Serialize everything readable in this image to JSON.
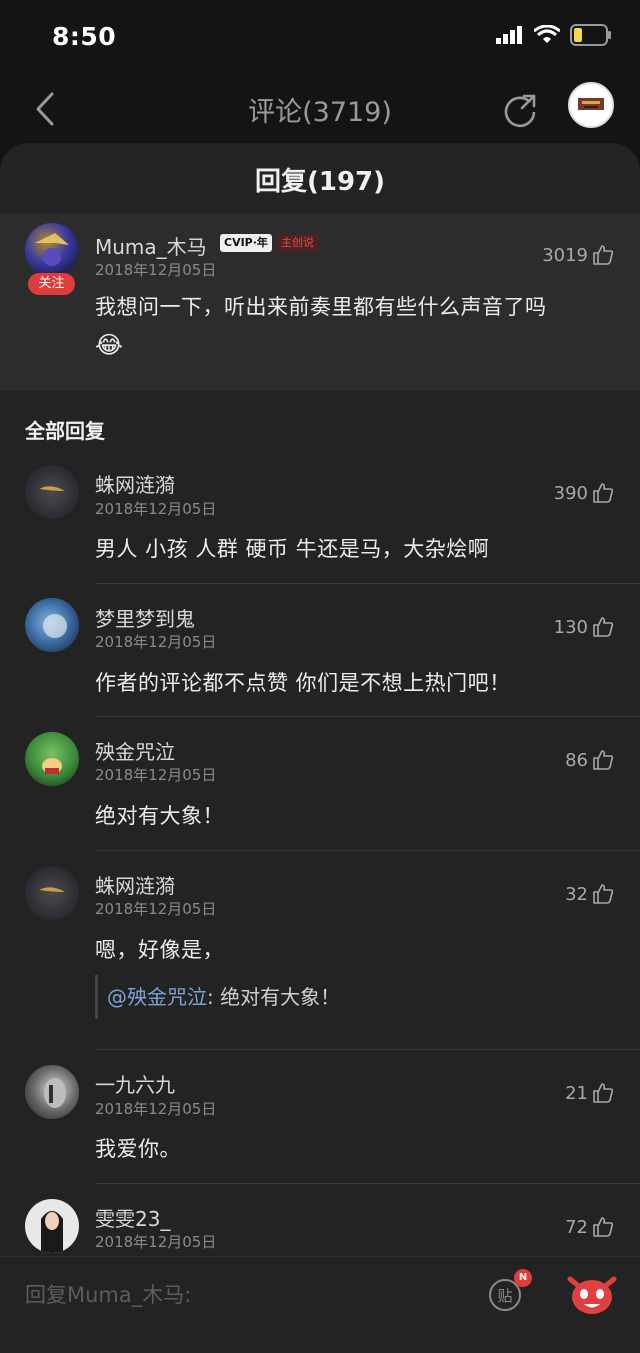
{
  "status": {
    "time": "8:50"
  },
  "nav": {
    "title": "评论(3719)"
  },
  "sheet": {
    "title": "回复(197)"
  },
  "main_comment": {
    "username": "Muma_木马",
    "vip_label": "CVIP·年",
    "creator_label": "主创说",
    "follow_label": "关注",
    "date": "2018年12月05日",
    "likes": "3019",
    "text": "我想问一下，听出来前奏里都有些什么声音了吗",
    "emoji": "😂"
  },
  "section_title": "全部回复",
  "replies": [
    {
      "username": "蛛网涟漪",
      "date": "2018年12月05日",
      "likes": "390",
      "text": "男人  小孩  人群  硬币  牛还是马，大杂烩啊"
    },
    {
      "username": "梦里梦到鬼",
      "date": "2018年12月05日",
      "likes": "130",
      "text": "作者的评论都不点赞 你们是不想上热门吧！"
    },
    {
      "username": "殃金咒泣",
      "date": "2018年12月05日",
      "likes": "86",
      "text": "绝对有大象！"
    },
    {
      "username": "蛛网涟漪",
      "date": "2018年12月05日",
      "likes": "32",
      "text": "嗯，好像是，",
      "quote_mention": "@殃金咒泣",
      "quote_text": ": 绝对有大象！"
    },
    {
      "username": "一九六九",
      "date": "2018年12月05日",
      "likes": "21",
      "text": "我爱你。"
    },
    {
      "username": "雯雯23_",
      "date": "2018年12月05日",
      "likes": "72"
    }
  ],
  "reply_bar": {
    "placeholder": "回复Muma_木马:",
    "sticker_label": "贴",
    "badge": "N"
  }
}
